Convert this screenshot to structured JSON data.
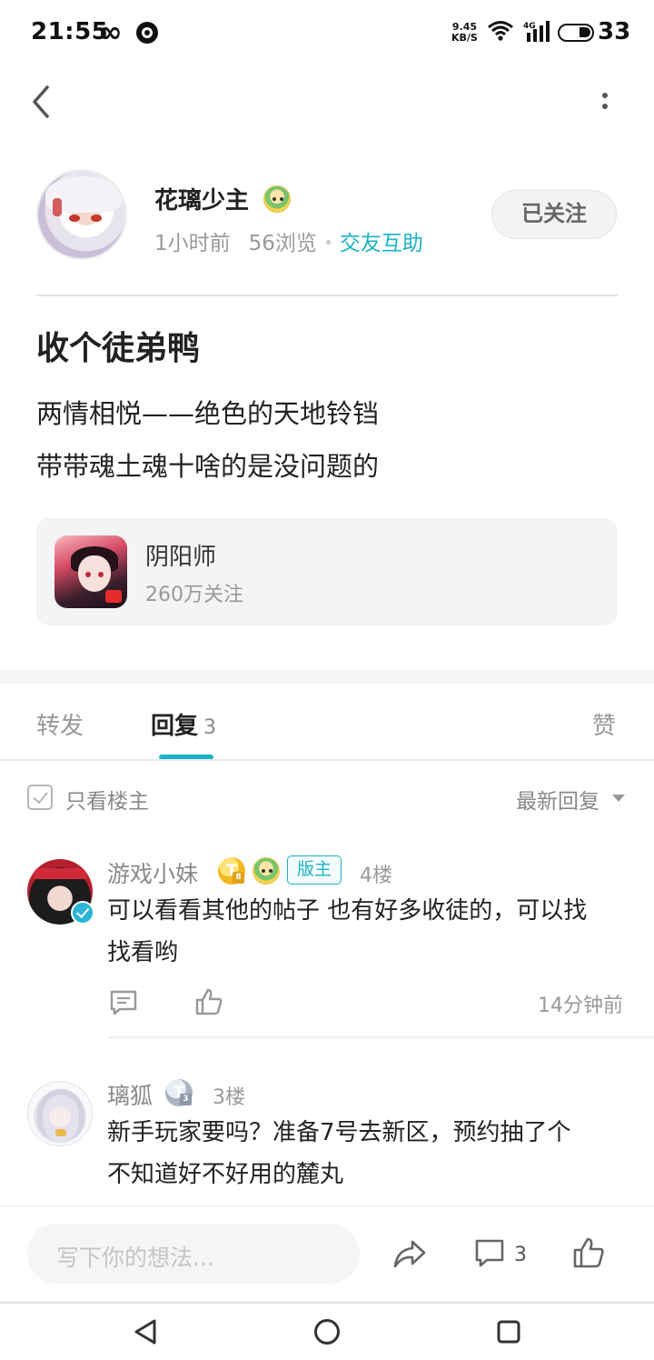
{
  "status_bar": {
    "time": "21:55",
    "speed_value": "9.45",
    "speed_unit": "KB/S",
    "network_label": "4G",
    "battery": "33"
  },
  "author": {
    "name": "花璃少主",
    "time_ago": "1小时前",
    "views": "56浏览",
    "topic": "交友互助",
    "follow_label": "已关注"
  },
  "post": {
    "title": "收个徒弟鸭",
    "lines": [
      "两情相悦——绝色的天地铃铛",
      "带带魂土魂十啥的是没问题的"
    ]
  },
  "game_card": {
    "name": "阴阳师",
    "followers": "260万关注"
  },
  "tabs": {
    "forward": "转发",
    "reply": "回复",
    "reply_count": "3",
    "like": "赞"
  },
  "filter": {
    "only_op": "只看楼主",
    "sort": "最新回复"
  },
  "replies": [
    {
      "name": "游戏小妹",
      "level": "T",
      "level_sub": "8",
      "mod_badge": "版主",
      "floor": "4楼",
      "text_line1": "可以看看其他的帖子 也有好多收徒的，可以找",
      "text_line2": "找看哟",
      "time": "14分钟前"
    },
    {
      "name": "璃狐",
      "level": "T",
      "level_sub": "3",
      "floor": "3楼",
      "text_line1": "新手玩家要吗？准备7号去新区，预约抽了个",
      "text_line2": "不知道好不好用的麓丸"
    }
  ],
  "bottom_bar": {
    "input_placeholder": "写下你的想法...",
    "comment_count": "3"
  },
  "colors": {
    "accent": "#1ab2c4",
    "text_primary": "#222222",
    "text_secondary": "#999999"
  }
}
